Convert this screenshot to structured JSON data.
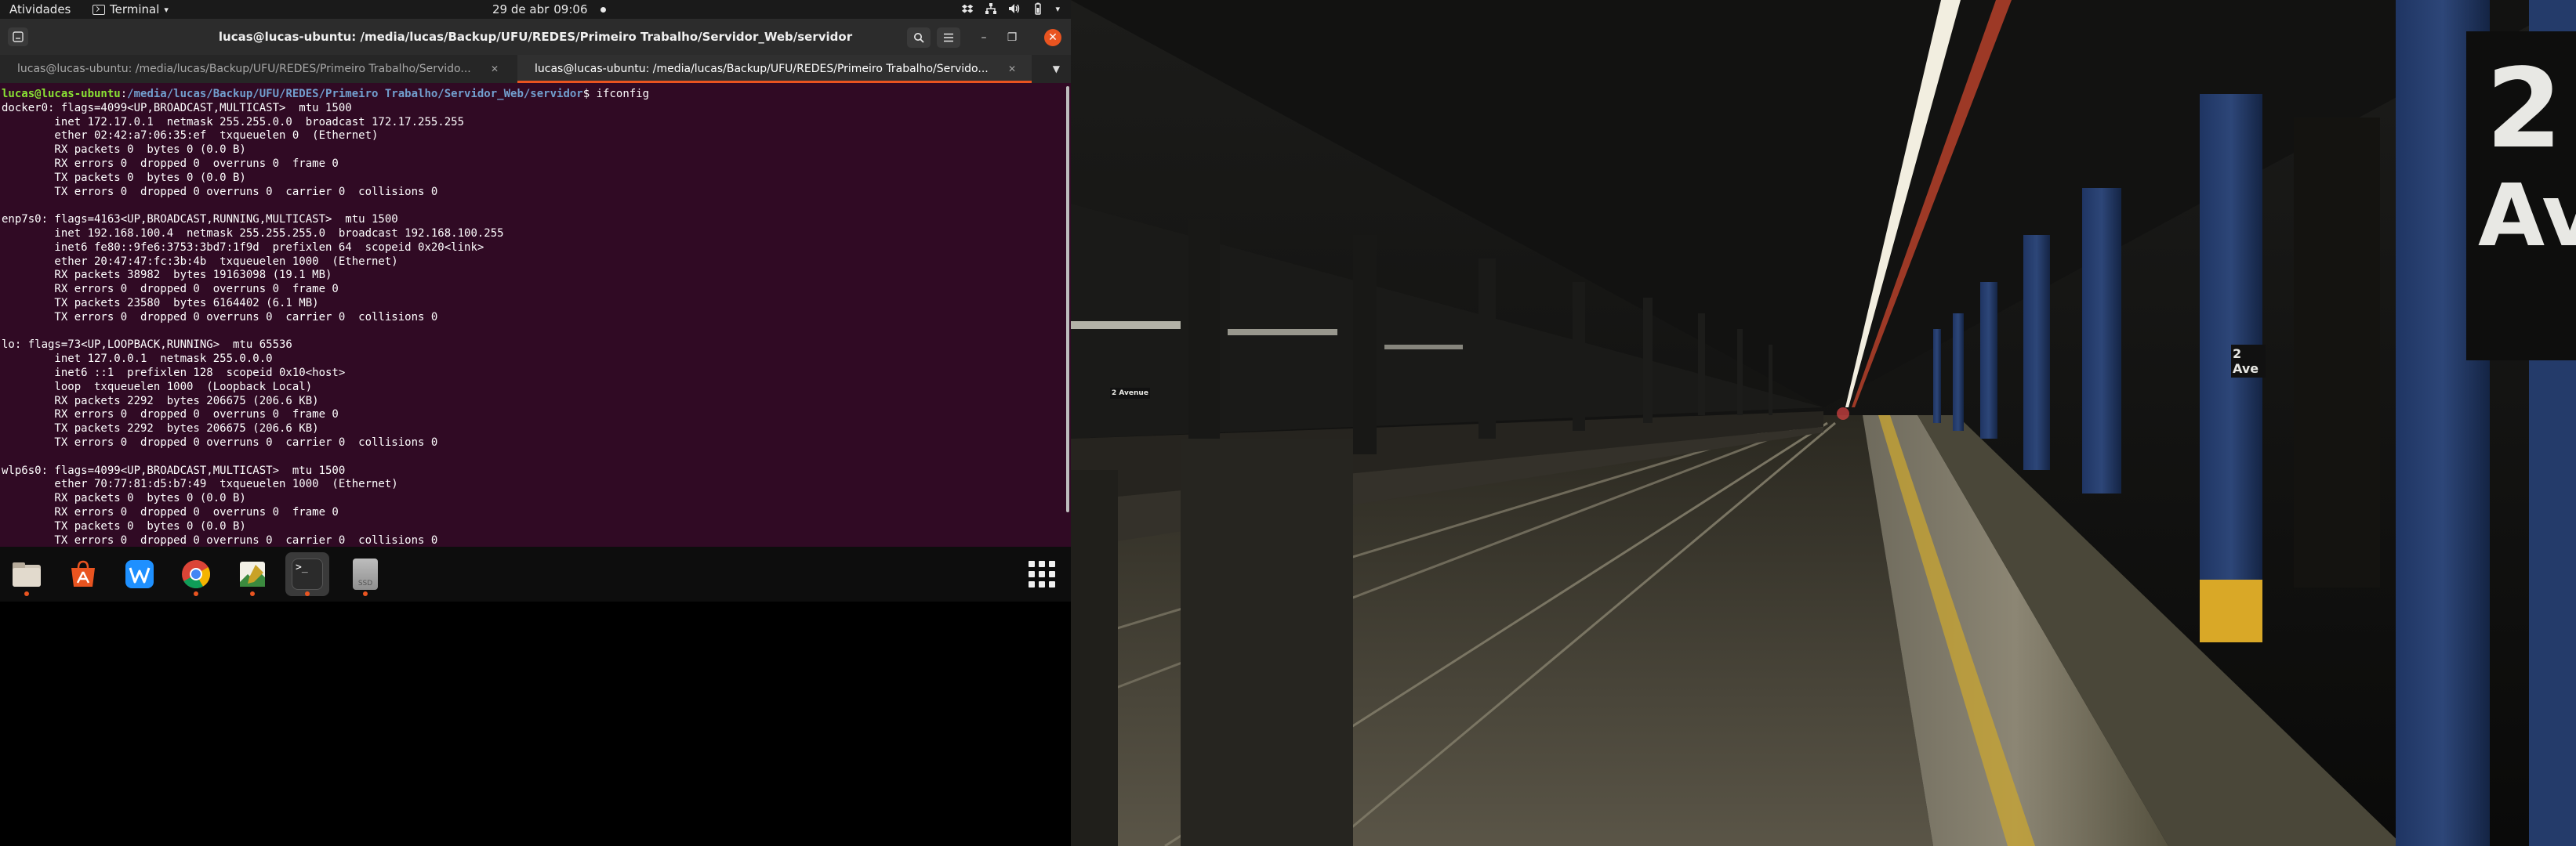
{
  "topbar": {
    "activities": "Atividades",
    "app_menu": "Terminal",
    "date": "29 de abr",
    "time": "09:06"
  },
  "terminal": {
    "window_title": "lucas@lucas-ubuntu: /media/lucas/Backup/UFU/REDES/Primeiro Trabalho/Servidor_Web/servidor",
    "tabs": [
      {
        "label": "lucas@lucas-ubuntu: /media/lucas/Backup/UFU/REDES/Primeiro Trabalho/Servido...",
        "active": false
      },
      {
        "label": "lucas@lucas-ubuntu: /media/lucas/Backup/UFU/REDES/Primeiro Trabalho/Servido...",
        "active": true
      }
    ],
    "prompt": {
      "user": "lucas@lucas-ubuntu",
      "path": "/media/lucas/Backup/UFU/REDES/Primeiro Trabalho/Servidor_Web/servidor",
      "command": "ifconfig"
    },
    "output": [
      "docker0: flags=4099<UP,BROADCAST,MULTICAST>  mtu 1500",
      "        inet 172.17.0.1  netmask 255.255.0.0  broadcast 172.17.255.255",
      "        ether 02:42:a7:06:35:ef  txqueuelen 0  (Ethernet)",
      "        RX packets 0  bytes 0 (0.0 B)",
      "        RX errors 0  dropped 0  overruns 0  frame 0",
      "        TX packets 0  bytes 0 (0.0 B)",
      "        TX errors 0  dropped 0 overruns 0  carrier 0  collisions 0",
      "",
      "enp7s0: flags=4163<UP,BROADCAST,RUNNING,MULTICAST>  mtu 1500",
      "        inet 192.168.100.4  netmask 255.255.255.0  broadcast 192.168.100.255",
      "        inet6 fe80::9fe6:3753:3bd7:1f9d  prefixlen 64  scopeid 0x20<link>",
      "        ether 20:47:47:fc:3b:4b  txqueuelen 1000  (Ethernet)",
      "        RX packets 38982  bytes 19163098 (19.1 MB)",
      "        RX errors 0  dropped 0  overruns 0  frame 0",
      "        TX packets 23580  bytes 6164402 (6.1 MB)",
      "        TX errors 0  dropped 0 overruns 0  carrier 0  collisions 0",
      "",
      "lo: flags=73<UP,LOOPBACK,RUNNING>  mtu 65536",
      "        inet 127.0.0.1  netmask 255.0.0.0",
      "        inet6 ::1  prefixlen 128  scopeid 0x10<host>",
      "        loop  txqueuelen 1000  (Loopback Local)",
      "        RX packets 2292  bytes 206675 (206.6 KB)",
      "        RX errors 0  dropped 0  overruns 0  frame 0",
      "        TX packets 2292  bytes 206675 (206.6 KB)",
      "        TX errors 0  dropped 0 overruns 0  carrier 0  collisions 0",
      "",
      "wlp6s0: flags=4099<UP,BROADCAST,MULTICAST>  mtu 1500",
      "        ether 70:77:81:d5:b7:49  txqueuelen 1000  (Ethernet)",
      "        RX packets 0  bytes 0 (0.0 B)",
      "        RX errors 0  dropped 0  overruns 0  frame 0",
      "        TX packets 0  bytes 0 (0.0 B)",
      "        TX errors 0  dropped 0 overruns 0  carrier 0  collisions 0"
    ]
  },
  "dock": {
    "items": [
      {
        "name": "files",
        "icon": "files-icon",
        "running": true
      },
      {
        "name": "software",
        "icon": "software-store-icon",
        "running": false
      },
      {
        "name": "wps",
        "icon": "wps-office-icon",
        "running": false
      },
      {
        "name": "chrome",
        "icon": "chrome-icon",
        "running": true
      },
      {
        "name": "text-editor",
        "icon": "text-editor-icon",
        "running": true
      },
      {
        "name": "terminal",
        "icon": "terminal-icon",
        "running": true
      },
      {
        "name": "ssd",
        "icon": "ssd-drive-icon",
        "running": true
      }
    ],
    "ssd_label": "SSD",
    "terminal_glyph": ">_"
  },
  "wallpaper": {
    "sign_number": "2",
    "sign_text": "Ave",
    "small_sign_text": "2 Ave",
    "station_sign_text": "2 Avenue"
  },
  "colors": {
    "accent": "#e95420",
    "terminal_bg": "#300a24",
    "prompt_user": "#8ae234",
    "prompt_path": "#729fcf"
  }
}
